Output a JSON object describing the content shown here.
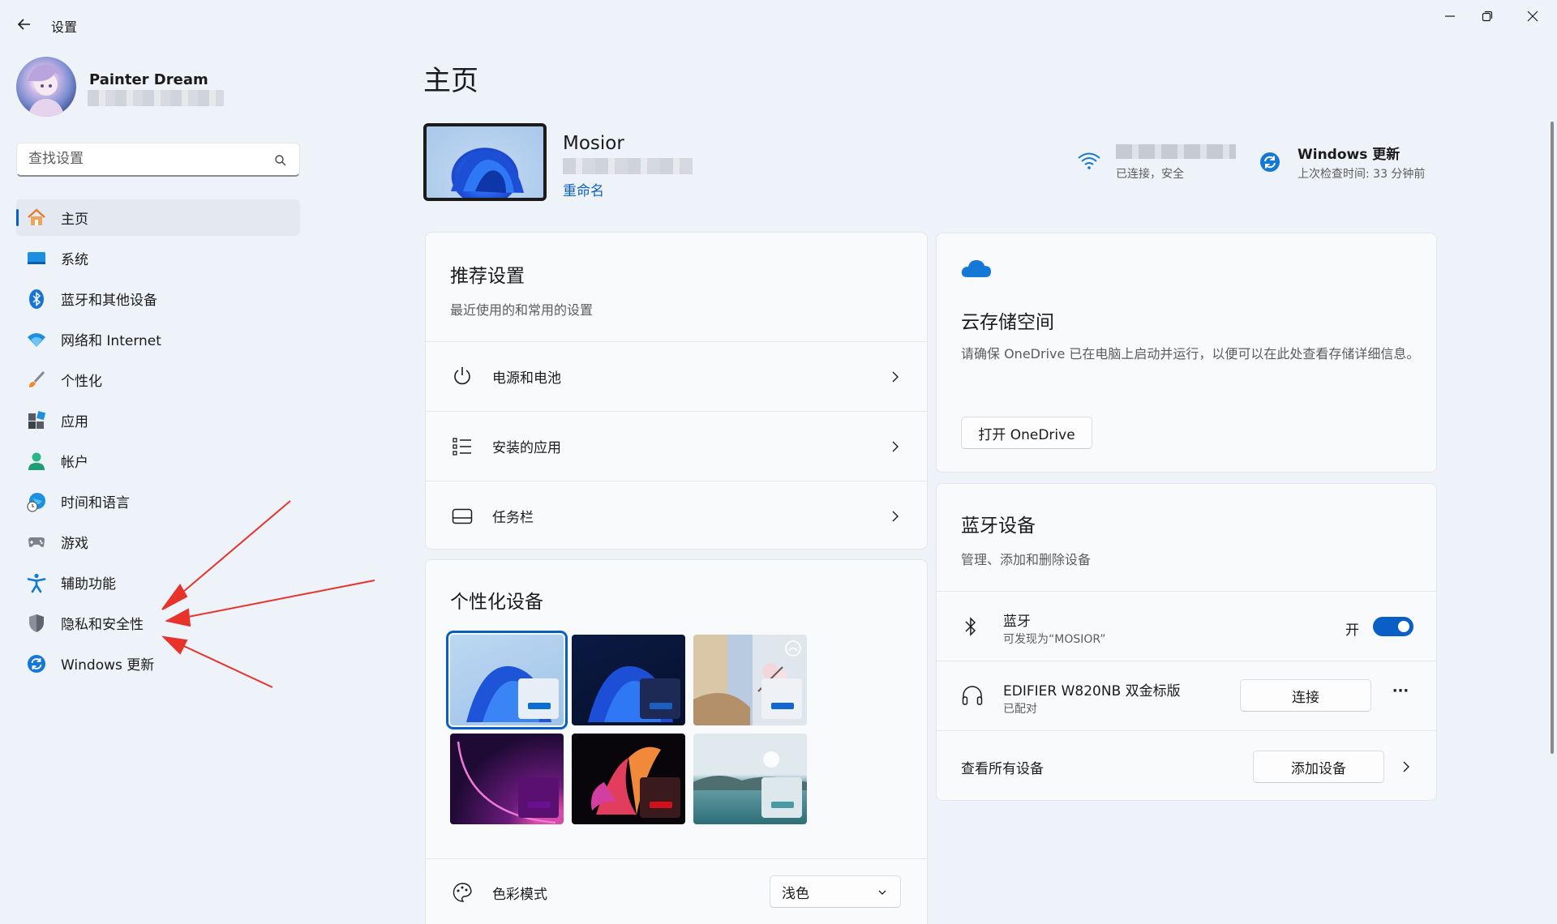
{
  "window": {
    "title": "设置"
  },
  "user": {
    "name": "Painter Dream"
  },
  "search": {
    "placeholder": "查找设置"
  },
  "nav": [
    {
      "label": "主页",
      "icon": "home-icon"
    },
    {
      "label": "系统",
      "icon": "system-icon"
    },
    {
      "label": "蓝牙和其他设备",
      "icon": "bluetooth-icon"
    },
    {
      "label": "网络和 Internet",
      "icon": "network-icon"
    },
    {
      "label": "个性化",
      "icon": "brush-icon"
    },
    {
      "label": "应用",
      "icon": "apps-icon"
    },
    {
      "label": "帐户",
      "icon": "account-icon"
    },
    {
      "label": "时间和语言",
      "icon": "clock-globe-icon"
    },
    {
      "label": "游戏",
      "icon": "gamepad-icon"
    },
    {
      "label": "辅助功能",
      "icon": "accessibility-icon"
    },
    {
      "label": "隐私和安全性",
      "icon": "shield-icon"
    },
    {
      "label": "Windows 更新",
      "icon": "windows-update-icon"
    }
  ],
  "main": {
    "title": "主页",
    "device": {
      "name": "Mosior",
      "rename": "重命名"
    },
    "network": {
      "status": "已连接，安全"
    },
    "update": {
      "title": "Windows 更新",
      "subtitle": "上次检查时间: 33 分钟前"
    }
  },
  "recommended": {
    "title": "推荐设置",
    "subtitle": "最近使用的和常用的设置",
    "items": [
      {
        "label": "电源和电池",
        "icon": "power-icon"
      },
      {
        "label": "安装的应用",
        "icon": "app-list-icon"
      },
      {
        "label": "任务栏",
        "icon": "taskbar-icon"
      }
    ]
  },
  "personalize": {
    "title": "个性化设备",
    "color_mode": {
      "label": "色彩模式",
      "value": "浅色"
    },
    "themes": [
      {
        "accent": "#0a6fd0",
        "selected": true
      },
      {
        "accent": "#1b5fc0",
        "selected": false
      },
      {
        "accent": "#1267d1",
        "selected": false
      },
      {
        "accent": "#6a0f8f",
        "selected": false
      },
      {
        "accent": "#d0111b",
        "selected": false
      },
      {
        "accent": "#4a9aa5",
        "selected": false
      }
    ]
  },
  "cloud": {
    "title": "云存储空间",
    "desc": "请确保 OneDrive 已在电脑上启动并运行，以便可以在此处查看存储详细信息。",
    "button": "打开 OneDrive"
  },
  "bluetooth": {
    "title": "蓝牙设备",
    "subtitle": "管理、添加和删除设备",
    "bt_row": {
      "label": "蓝牙",
      "sub": "可发现为“MOSIOR”",
      "state": "开"
    },
    "device_row": {
      "label": "EDIFIER W820NB 双金标版",
      "sub": "已配对",
      "button": "连接",
      "more": "···"
    },
    "all_row": {
      "label": "查看所有设备",
      "button": "添加设备"
    }
  },
  "colors": {
    "accent": "#0a5fc7",
    "arrow": "#e8332c"
  }
}
